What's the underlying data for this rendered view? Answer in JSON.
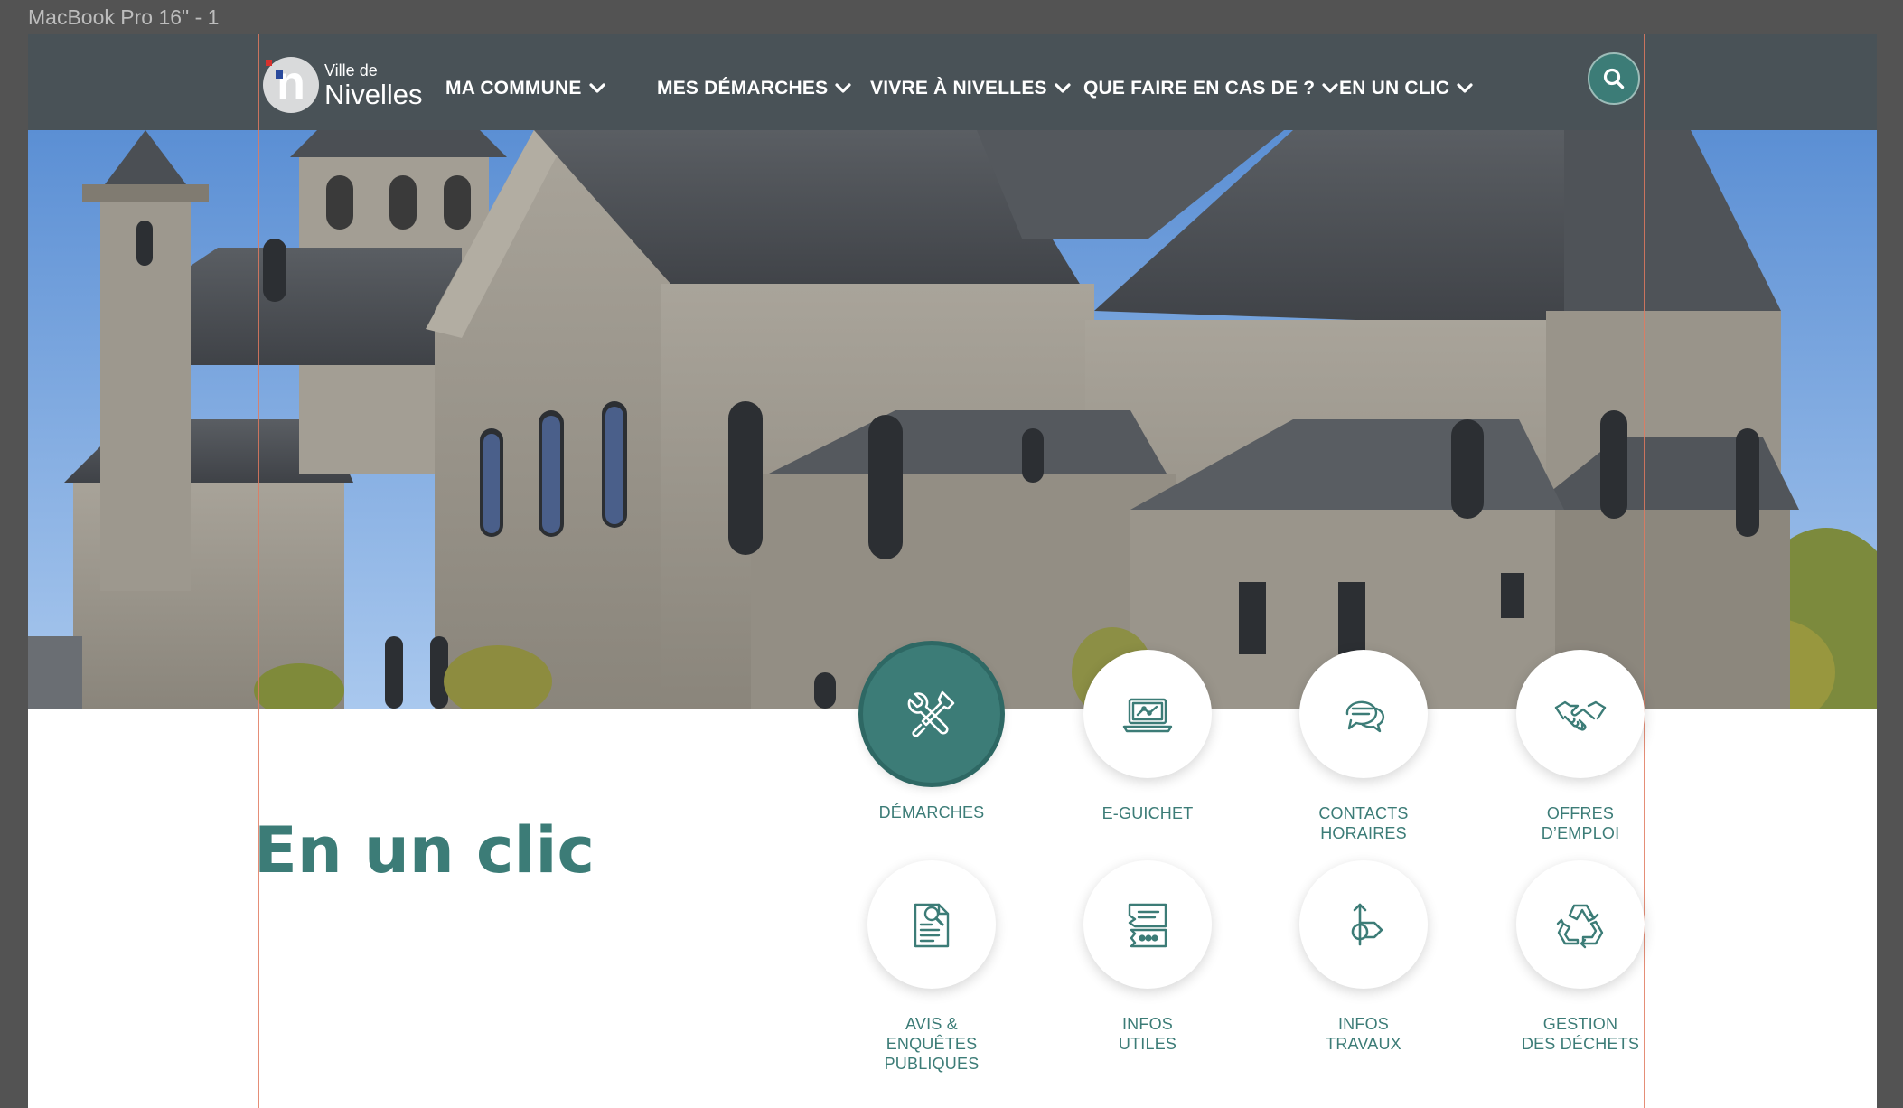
{
  "frame": {
    "label": "MacBook Pro 16\" - 1"
  },
  "logo": {
    "line1": "Ville de",
    "line2": "Nivelles",
    "letter": "n"
  },
  "nav": {
    "items": [
      {
        "label": "MA COMMUNE"
      },
      {
        "label": "MES DÉMARCHES"
      },
      {
        "label": "VIVRE À NIVELLES"
      },
      {
        "label": "QUE FAIRE EN CAS DE ?"
      },
      {
        "label": "EN UN CLIC"
      }
    ]
  },
  "hero": {
    "description_icon": "collegiate-church-photo"
  },
  "section": {
    "title": "En un clic",
    "tiles": [
      {
        "icon": "tools-icon",
        "lines": [
          "DÉMARCHES"
        ],
        "active": true
      },
      {
        "icon": "laptop-icon",
        "lines": [
          "E-GUICHET"
        ]
      },
      {
        "icon": "chat-icon",
        "lines": [
          "CONTACTS",
          "HORAIRES"
        ]
      },
      {
        "icon": "handshake-icon",
        "lines": [
          "OFFRES",
          "D’EMPLOI"
        ]
      },
      {
        "icon": "document-search-icon",
        "lines": [
          "AVIS &",
          "ENQUÊTES",
          "PUBLIQUES"
        ]
      },
      {
        "icon": "ticket-icon",
        "lines": [
          "INFOS",
          "UTILES"
        ]
      },
      {
        "icon": "road-sign-icon",
        "lines": [
          "INFOS",
          "TRAVAUX"
        ]
      },
      {
        "icon": "recycle-icon",
        "lines": [
          "GESTION",
          "DES DÉCHETS"
        ]
      }
    ]
  },
  "colors": {
    "header": "#495257",
    "accent": "#3c7c77",
    "canvas": "#535353"
  }
}
